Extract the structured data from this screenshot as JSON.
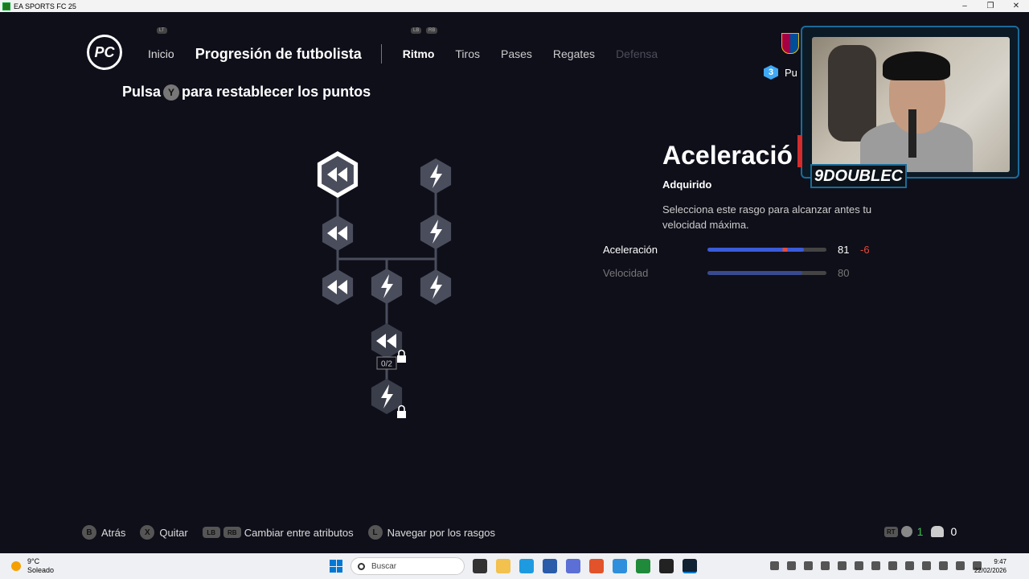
{
  "window": {
    "title": "EA SPORTS FC 25",
    "controls": [
      "–",
      "❐",
      "✕"
    ]
  },
  "header": {
    "logo_text": "PC",
    "lt_label": "LT",
    "lb_label": "LB",
    "rb_label": "RB",
    "home_label": "Inicio",
    "page_title": "Progresión de futbolista",
    "tabs": [
      {
        "label": "Ritmo",
        "state": "active"
      },
      {
        "label": "Tiros",
        "state": "normal"
      },
      {
        "label": "Pases",
        "state": "normal"
      },
      {
        "label": "Regates",
        "state": "normal"
      },
      {
        "label": "Defensa",
        "state": "disabled"
      }
    ],
    "points_count": "3",
    "points_label": "Pu"
  },
  "reset_hint": {
    "prefix": "Pulsa",
    "button": "Y",
    "suffix": "para restablecer los puntos"
  },
  "skill_tree": {
    "lock_counter": "0/2",
    "nodes": [
      {
        "icon": "rewind-icon",
        "state": "selected"
      },
      {
        "icon": "lightning-icon",
        "state": "acquired"
      },
      {
        "icon": "rewind-icon",
        "state": "acquired"
      },
      {
        "icon": "lightning-icon",
        "state": "acquired"
      },
      {
        "icon": "rewind-icon",
        "state": "acquired"
      },
      {
        "icon": "lightning-icon",
        "state": "acquired"
      },
      {
        "icon": "lightning-icon",
        "state": "acquired"
      },
      {
        "icon": "rewind-icon",
        "state": "locked"
      },
      {
        "icon": "lightning-icon",
        "state": "locked"
      }
    ]
  },
  "detail": {
    "title": "Aceleració",
    "status": "Adquirido",
    "description": "Selecciona este rasgo para alcanzar antes tu velocidad máxima.",
    "stats": [
      {
        "label": "Aceleración",
        "value": "81",
        "delta": "-6",
        "fill": 0.81,
        "highlight": true
      },
      {
        "label": "Velocidad",
        "value": "80",
        "delta": "",
        "fill": 0.8,
        "highlight": false
      }
    ]
  },
  "webcam": {
    "name": "9DOUBLEC"
  },
  "bottom_hints": [
    {
      "button": "B",
      "label": "Atrás"
    },
    {
      "button": "X",
      "label": "Quitar"
    },
    {
      "button": "LB",
      "button2": "RB",
      "label": "Cambiar entre atributos"
    },
    {
      "button": "L",
      "label": "Navegar por los rasgos"
    }
  ],
  "bottom_right": {
    "rt": "RT",
    "green_count": "1",
    "people_count": "0"
  },
  "taskbar": {
    "temperature": "9°C",
    "weather": "Soleado",
    "search_placeholder": "Buscar",
    "time": "9:47",
    "date": "22/02/2026"
  },
  "colors": {
    "accent_blue": "#3a5bd9",
    "delta_red": "#e34a3a",
    "points_blue": "#3fa9f5"
  }
}
